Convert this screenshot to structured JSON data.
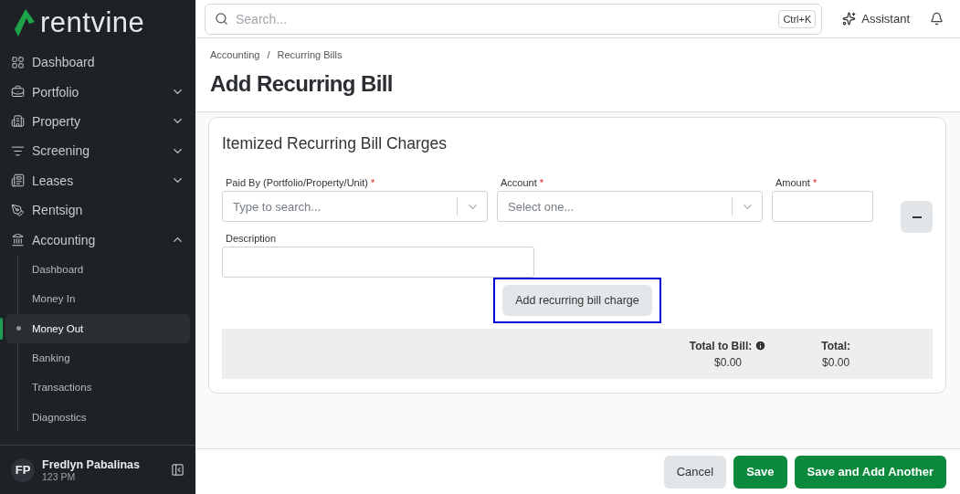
{
  "sidebar": {
    "logo": "rentvine",
    "items": [
      {
        "label": "Dashboard"
      },
      {
        "label": "Portfolio",
        "expanded": false
      },
      {
        "label": "Property",
        "expanded": false
      },
      {
        "label": "Screening",
        "expanded": false
      },
      {
        "label": "Leases",
        "expanded": false
      },
      {
        "label": "Rentsign"
      },
      {
        "label": "Accounting",
        "expanded": true,
        "children": [
          {
            "label": "Dashboard",
            "selected": false
          },
          {
            "label": "Money In",
            "selected": false
          },
          {
            "label": "Money Out",
            "selected": true
          },
          {
            "label": "Banking",
            "selected": false
          },
          {
            "label": "Transactions",
            "selected": false
          },
          {
            "label": "Diagnostics",
            "selected": false
          }
        ]
      }
    ],
    "user": {
      "initials": "FP",
      "name": "Fredlyn Pabalinas",
      "subtitle": "123 PM"
    }
  },
  "topbar": {
    "search": {
      "placeholder": "Search..."
    },
    "shortcut": "Ctrl+K",
    "assistant": "Assistant"
  },
  "breadcrumbs": [
    "Accounting",
    "Recurring Bills"
  ],
  "breadcrumb_separator": "/",
  "title": "Add Recurring Bill",
  "required_mark": "*",
  "card": {
    "title": "Itemized Recurring Bill Charges",
    "fields": [
      {
        "label": "Paid By (Portfolio/Property/Unit)",
        "required": true,
        "kind": "select",
        "placeholder": "Type to search..."
      },
      {
        "label": "Account",
        "required": true,
        "kind": "select",
        "placeholder": "Select one..."
      },
      {
        "label": "Amount",
        "required": true,
        "kind": "input"
      }
    ],
    "description": {
      "label": "Description"
    },
    "add_button": {
      "label": "Add recurring bill charge",
      "focused": true
    },
    "totals": [
      {
        "label": "Total to Bill:",
        "info": true,
        "value": "$0.00"
      },
      {
        "label": "Total:",
        "info": false,
        "value": "$0.00"
      }
    ]
  },
  "footer": {
    "buttons": [
      {
        "label": "Cancel",
        "kind": "secondary"
      },
      {
        "label": "Save",
        "kind": "primary"
      },
      {
        "label": "Save and Add Another",
        "kind": "primary"
      }
    ]
  }
}
